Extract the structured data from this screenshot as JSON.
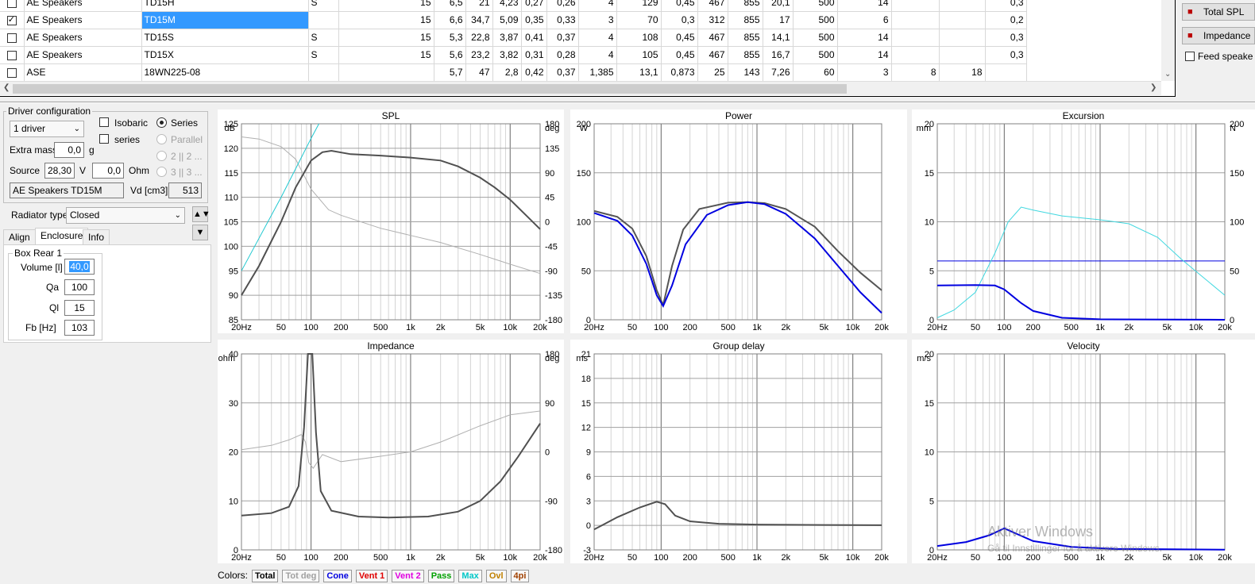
{
  "table": {
    "rows": [
      {
        "checked": false,
        "brand": "AE Speakers",
        "model": "TD15H",
        "type": "S",
        "selected": false,
        "vals": [
          "15",
          "6,5",
          "21",
          "4,23",
          "0,27",
          "0,26",
          "4",
          "129",
          "0,45",
          "467",
          "855",
          "20,1",
          "500",
          "14",
          "",
          "",
          "0,3"
        ]
      },
      {
        "checked": true,
        "brand": "AE Speakers",
        "model": "TD15M",
        "type": "",
        "selected": true,
        "vals": [
          "15",
          "6,6",
          "34,7",
          "5,09",
          "0,35",
          "0,33",
          "3",
          "70",
          "0,3",
          "312",
          "855",
          "17",
          "500",
          "6",
          "",
          "",
          "0,2"
        ]
      },
      {
        "checked": false,
        "brand": "AE Speakers",
        "model": "TD15S",
        "type": "S",
        "selected": false,
        "vals": [
          "15",
          "5,3",
          "22,8",
          "3,87",
          "0,41",
          "0,37",
          "4",
          "108",
          "0,45",
          "467",
          "855",
          "14,1",
          "500",
          "14",
          "",
          "",
          "0,3"
        ]
      },
      {
        "checked": false,
        "brand": "AE Speakers",
        "model": "TD15X",
        "type": "S",
        "selected": false,
        "vals": [
          "15",
          "5,6",
          "23,2",
          "3,82",
          "0,31",
          "0,28",
          "4",
          "105",
          "0,45",
          "467",
          "855",
          "16,7",
          "500",
          "14",
          "",
          "",
          "0,3"
        ]
      },
      {
        "checked": false,
        "brand": "ASE",
        "model": "18WN225-08",
        "type": "",
        "selected": false,
        "vals": [
          "",
          "5,7",
          "47",
          "2,8",
          "0,42",
          "0,37",
          "1,385",
          "13,1",
          "0,873",
          "25",
          "143",
          "7,26",
          "60",
          "3",
          "8",
          "18",
          ""
        ]
      }
    ]
  },
  "side_buttons": {
    "total_spl": "Total SPL",
    "impedance": "Impedance",
    "feed_speaker": "Feed speake"
  },
  "driver_config": {
    "title": "Driver configuration",
    "count": "1 driver",
    "isobaric": "Isobaric",
    "series_chk": "series",
    "series": "Series",
    "parallel": "Parallel",
    "r2": "2 || 2 ...",
    "r3": "3 || 3 ...",
    "extra_mass_label": "Extra mass",
    "extra_mass": "0,0",
    "extra_mass_unit": "g",
    "source_label": "Source",
    "source_v": "28,30",
    "source_v_unit": "V",
    "source_ohm": "0,0",
    "source_ohm_unit": "Ohm",
    "driver_name": "AE Speakers TD15M",
    "vd_label": "Vd [cm3]",
    "vd": "513"
  },
  "radiator": {
    "label": "Radiator type",
    "value": "Closed"
  },
  "tabs": {
    "align": "Align",
    "enclosure": "Enclosure",
    "info": "Info"
  },
  "box": {
    "title": "Box Rear 1",
    "volume_label": "Volume [l]",
    "volume": "40,0",
    "qa_label": "Qa",
    "qa": "100",
    "ql_label": "Ql",
    "ql": "15",
    "fb_label": "Fb [Hz]",
    "fb": "103"
  },
  "freq_ticks": [
    "20Hz",
    "50",
    "100",
    "200",
    "500",
    "1k",
    "2k",
    "5k",
    "10k",
    "20k"
  ],
  "charts": {
    "spl": {
      "title": "SPL",
      "y_unit": "dB",
      "y2_unit": "deg",
      "y_ticks": [
        "85",
        "90",
        "95",
        "100",
        "105",
        "110",
        "115",
        "120",
        "125"
      ],
      "y2_ticks": [
        "-180",
        "-135",
        "-90",
        "-45",
        "0",
        "45",
        "90",
        "135",
        "180"
      ]
    },
    "power": {
      "title": "Power",
      "y_unit": "W",
      "y_ticks": [
        "0",
        "50",
        "100",
        "150",
        "200"
      ]
    },
    "excursion": {
      "title": "Excursion",
      "y_unit": "mm",
      "y2_unit": "N",
      "y_ticks": [
        "0",
        "5",
        "10",
        "15",
        "20"
      ],
      "y2_ticks": [
        "0",
        "50",
        "100",
        "150",
        "200"
      ]
    },
    "impedance": {
      "title": "Impedance",
      "y_unit": "ohm",
      "y2_unit": "deg",
      "y_ticks": [
        "0",
        "10",
        "20",
        "30",
        "40"
      ],
      "y2_ticks": [
        "-180",
        "-90",
        "0",
        "90",
        "180"
      ]
    },
    "group_delay": {
      "title": "Group delay",
      "y_unit": "ms",
      "y_ticks": [
        "-3",
        "0",
        "3",
        "6",
        "9",
        "12",
        "15",
        "18",
        "21"
      ]
    },
    "velocity": {
      "title": "Velocity",
      "y_unit": "m/s",
      "y_ticks": [
        "0",
        "5",
        "10",
        "15",
        "20"
      ]
    }
  },
  "colors": {
    "label": "Colors:",
    "items": [
      {
        "text": "Total",
        "color": "#000000"
      },
      {
        "text": "Tot deg",
        "color": "#a0a0a0"
      },
      {
        "text": "Cone",
        "color": "#0000e0"
      },
      {
        "text": "Vent 1",
        "color": "#e00000"
      },
      {
        "text": "Vent 2",
        "color": "#e000e0"
      },
      {
        "text": "Pass",
        "color": "#00a000"
      },
      {
        "text": "Max",
        "color": "#00c8c8"
      },
      {
        "text": "Ovl",
        "color": "#c08000"
      },
      {
        "text": "4pi",
        "color": "#a04000"
      }
    ]
  },
  "watermark": {
    "line1": "Aktiver Windows",
    "line2": "Gå til Innstillinger for å aktivere Windows."
  }
}
